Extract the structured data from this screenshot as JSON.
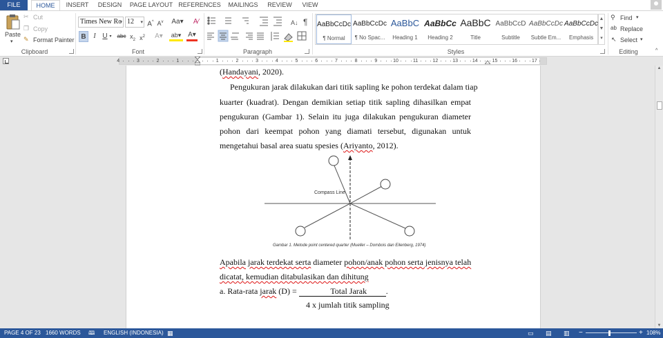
{
  "tabs": [
    "FILE",
    "HOME",
    "INSERT",
    "DESIGN",
    "PAGE LAYOUT",
    "REFERENCES",
    "MAILINGS",
    "REVIEW",
    "VIEW"
  ],
  "clipboard": {
    "paste": "Paste",
    "cut": "Cut",
    "copy": "Copy",
    "format_painter": "Format Painter",
    "label": "Clipboard"
  },
  "font": {
    "name": "Times New Ro",
    "size": "12",
    "label": "Font"
  },
  "paragraph": {
    "label": "Paragraph"
  },
  "styles": {
    "label": "Styles",
    "items": [
      {
        "preview": "AaBbCcDc",
        "name": "¶ Normal"
      },
      {
        "preview": "AaBbCcDc",
        "name": "¶ No Spac..."
      },
      {
        "preview": "AaBbC",
        "name": "Heading 1"
      },
      {
        "preview": "AaBbCc",
        "name": "Heading 2"
      },
      {
        "preview": "AaBbC",
        "name": "Title"
      },
      {
        "preview": "AaBbCcD",
        "name": "Subtitle"
      },
      {
        "preview": "AaBbCcDc",
        "name": "Subtle Em..."
      },
      {
        "preview": "AaBbCcDc",
        "name": "Emphasis"
      }
    ]
  },
  "editing": {
    "find": "Find",
    "replace": "Replace",
    "select": "Select",
    "label": "Editing"
  },
  "ruler": {
    "left_numbers": [
      "4",
      "3",
      "2",
      "1"
    ],
    "right_numbers": [
      "1",
      "2",
      "3",
      "4",
      "5",
      "6",
      "7",
      "8",
      "9",
      "10",
      "11",
      "12",
      "13",
      "14",
      "15",
      "16",
      "17"
    ]
  },
  "document": {
    "line0": {
      "cite": "Handayani",
      "rest": ", 2020)."
    },
    "para1": {
      "line1": "Pengukuran jarak dilakukan dari titik sapling ke pohon terdekat dalam tiap",
      "line2": "kuarter (kuadrat). Dengan demikian setiap titik sapling dihasilkan empat",
      "line3": "pengukuran (Gambar 1). Selain itu juga dilakukan pengukuran diameter",
      "line4": "pohon dari keempat pohon yang diamati tersebut, digunakan untuk",
      "line5a": "mengetahui basal area suatu spesies (",
      "line5cite": "Ariyanto",
      "line5b": ", 2012)."
    },
    "figure": {
      "compass_label": "Compass Line",
      "caption": "Gambar 1. Metode point centered quarter (Mueller – Dombois dan Eilenberg, 1974)"
    },
    "para2": {
      "l1w1": "Apabila",
      "l1w2": " ",
      "l1w3": "jarak terdekat serta",
      "l1w4": " diameter ",
      "l1w5": "pohon/anak pohon serta jenisnya telah",
      "l2w1": "dicatat, kemudian ditabulasikan dan dihitung"
    },
    "formula": {
      "label": "a.  Rata-rata ",
      "jarak": "jarak",
      "suffix": " (D) = ",
      "numerator": "Total Jarak",
      "end": ".",
      "denominator": "4 x jumlah titik sampling"
    }
  },
  "status": {
    "page": "PAGE 4 OF 23",
    "words": "1660 WORDS",
    "language": "ENGLISH (INDONESIA)",
    "zoom": "108%"
  }
}
